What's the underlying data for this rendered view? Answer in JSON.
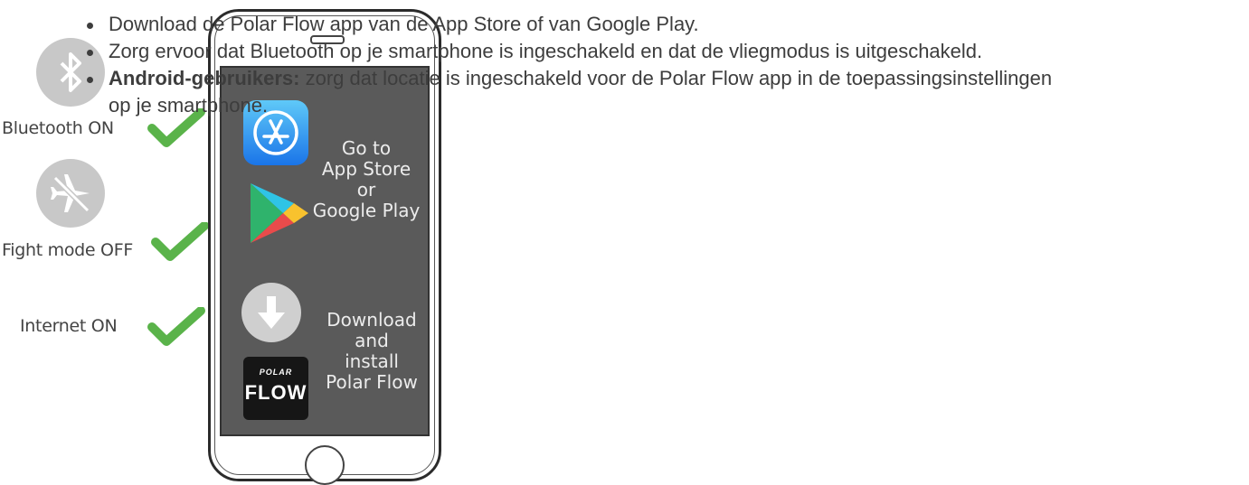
{
  "left_column": {
    "bluetooth_label": "Bluetooth ON",
    "flight_label": "Fight mode OFF",
    "internet_label": "Internet ON"
  },
  "phone": {
    "store_text": [
      "Go to",
      "App Store",
      "or",
      "Google Play"
    ],
    "download_text": [
      "Download",
      "and",
      "install",
      "Polar Flow"
    ],
    "polar_logo_top": "POLAR",
    "polar_logo_bottom": "FLOW"
  },
  "bullets": [
    {
      "text": "Download de Polar Flow app van de App Store of van Google Play."
    },
    {
      "text": "Zorg ervoor dat Bluetooth op je smartphone is ingeschakeld en dat de vliegmodus is uitgeschakeld."
    },
    {
      "bold": "Android-gebruikers:",
      "text": " zorg dat locatie is ingeschakeld voor de Polar Flow app in de toepassingsinstellingen",
      "continuation": "op je smartphone."
    }
  ],
  "colors": {
    "check": "#5ab34a",
    "screen": "#5a5a5a",
    "status_icon": "#c8c8c8"
  }
}
